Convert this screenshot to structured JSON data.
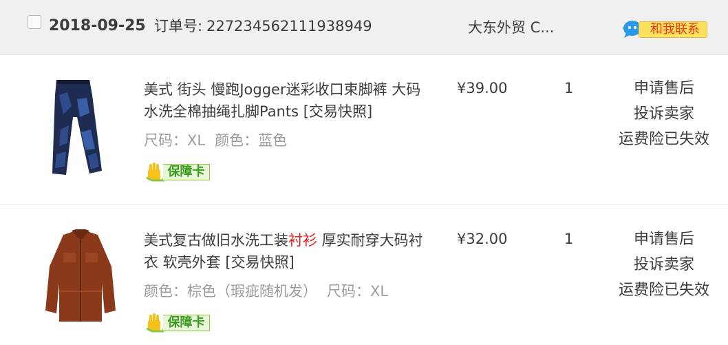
{
  "order": {
    "date": "2018-09-25",
    "number_label": "订单号:",
    "number": "227234562111938949",
    "shop": "大东外贸 C...",
    "contact_label": "和我联系"
  },
  "items": [
    {
      "title_pre": "美式 街头 慢跑Jogger迷彩收口束脚裤 大码水洗全棉抽绳扎脚Pants",
      "title_highlight": "",
      "title_post": "",
      "snapshot": "[交易快照]",
      "props": [
        "尺码：XL",
        "颜色：蓝色"
      ],
      "guarantee": "保障卡",
      "price": "¥39.00",
      "quantity": "1",
      "actions": [
        "申请售后",
        "投诉卖家",
        "运费险已失效"
      ]
    },
    {
      "title_pre": "美式复古做旧水洗工装",
      "title_highlight": "衬衫",
      "title_post": " 厚实耐穿大码衬衣 软壳外套",
      "snapshot": "[交易快照]",
      "props": [
        "颜色：棕色（瑕疵随机发）",
        "尺码：XL"
      ],
      "guarantee": "保障卡",
      "price": "¥32.00",
      "quantity": "1",
      "actions": [
        "申请售后",
        "投诉卖家",
        "运费险已失效"
      ]
    }
  ],
  "colors": {
    "header_bg": "#f0f0f0",
    "highlight": "#e3211c",
    "muted": "#9c9c9c",
    "contact_bg": "#fde15d",
    "guarantee_green": "#3a9c1f"
  },
  "icons": {
    "contact": "chat-bubble-icon",
    "guarantee": "yellow-hand-icon",
    "item1_image": "jeans-product-image",
    "item2_image": "shirt-product-image"
  }
}
